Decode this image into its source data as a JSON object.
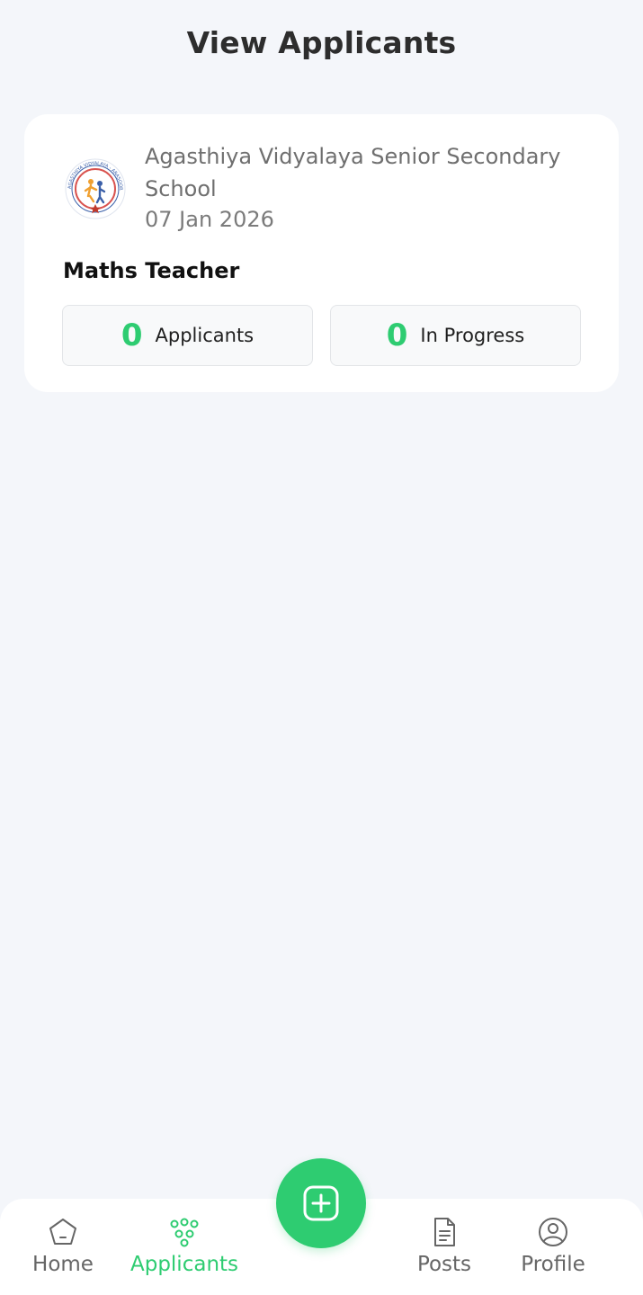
{
  "header": {
    "title": "View Applicants"
  },
  "job_card": {
    "school_name": "Agasthiya Vidyalaya Senior Secondary School",
    "logo_text": "AGASTHIYA VIDYALAYA - ARASOOR - VANDAVASI",
    "date": "07 Jan 2026",
    "job_title": "Maths Teacher",
    "stats": {
      "applicants": {
        "count": "0",
        "label": "Applicants"
      },
      "in_progress": {
        "count": "0",
        "label": "In Progress"
      }
    }
  },
  "nav": {
    "home": "Home",
    "applicants": "Applicants",
    "posts": "Posts",
    "profile": "Profile"
  },
  "colors": {
    "accent": "#2ecc71",
    "background": "#f4f6fa",
    "card": "#ffffff"
  },
  "icons": {
    "fab": "plus-square-icon",
    "home": "home-icon",
    "applicants": "people-icon",
    "posts": "document-icon",
    "profile": "user-circle-icon"
  }
}
